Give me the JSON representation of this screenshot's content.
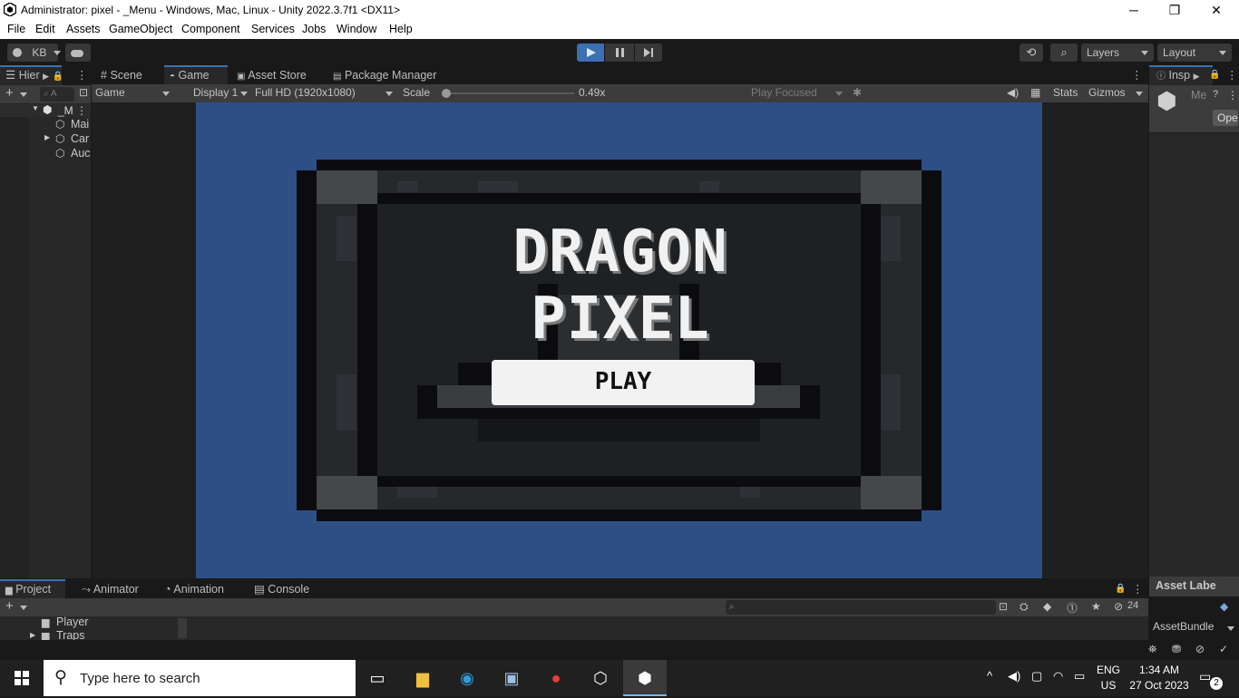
{
  "window": {
    "title": "Administrator: pixel - _Menu - Windows, Mac, Linux - Unity 2022.3.7f1 <DX11>",
    "minimize": "─",
    "restore": "❐",
    "close": "✕"
  },
  "menu": [
    "File",
    "Edit",
    "Assets",
    "GameObject",
    "Component",
    "Services",
    "Jobs",
    "Window",
    "Help"
  ],
  "toolbar": {
    "account": "KB",
    "layers": "Layers",
    "layout": "Layout"
  },
  "hierarchy": {
    "tab": "Hier",
    "search_placeholder": "A",
    "scene": "_M",
    "items": [
      "Mai",
      "Car",
      "Auc"
    ]
  },
  "center_tabs": [
    "Scene",
    "Game",
    "Asset Store",
    "Package Manager"
  ],
  "game_bar": {
    "mode": "Game",
    "display": "Display 1",
    "resolution": "Full HD (1920x1080)",
    "scale_label": "Scale",
    "scale_value": "0.49x",
    "scale_fraction": 0.0,
    "play_focused": "Play Focused",
    "stats": "Stats",
    "gizmos": "Gizmos"
  },
  "game": {
    "title": "DRAGON PIXEL",
    "play_button": "PLAY"
  },
  "inspector": {
    "tab": "Insp",
    "name": "Me",
    "open": "Open",
    "asset_labels": "Asset Labe",
    "asset_bundle": "AssetBundle"
  },
  "bottom_tabs": [
    "Project",
    "Animator",
    "Animation",
    "Console"
  ],
  "project": {
    "folders": [
      "Player",
      "Traps"
    ],
    "hidden_count": "24"
  },
  "taskbar": {
    "search": "Type here to search",
    "lang1": "ENG",
    "lang2": "US",
    "time": "1:34 AM",
    "date": "27 Oct 2023",
    "notifications": "2"
  },
  "colors": {
    "accent": "#3a72b0",
    "game_bg": "#2e4f86",
    "play_active": "#3d6fb3"
  }
}
